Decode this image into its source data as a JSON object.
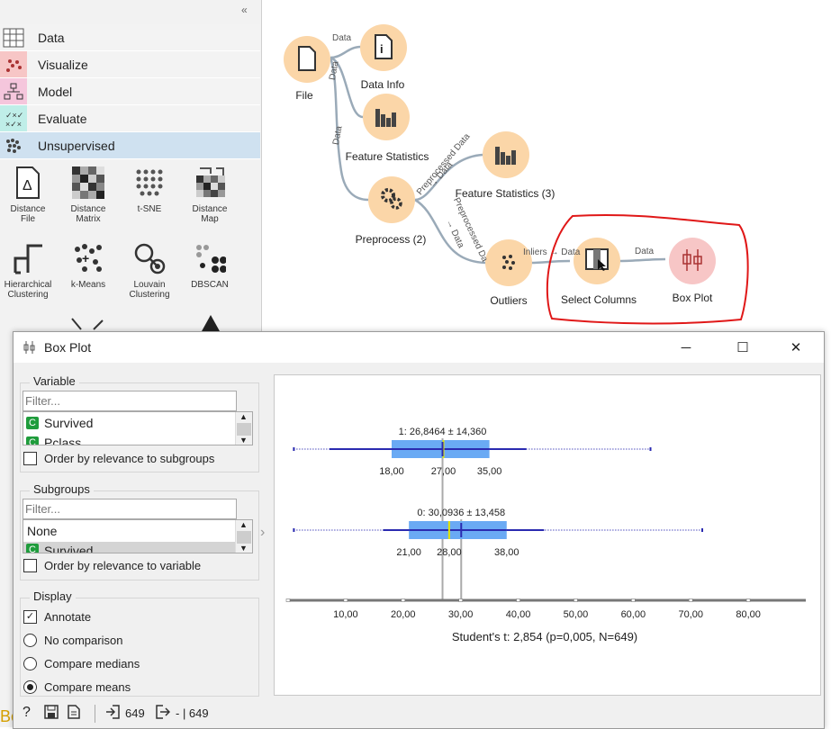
{
  "toolbox": {
    "categories": [
      {
        "label": "Data",
        "color": "#f3f3f3"
      },
      {
        "label": "Visualize",
        "color": "#f3f3f3"
      },
      {
        "label": "Model",
        "color": "#f3f3f3"
      },
      {
        "label": "Evaluate",
        "color": "#f3f3f3"
      },
      {
        "label": "Unsupervised",
        "color": "#cfe1f0"
      }
    ],
    "widgets": [
      {
        "label1": "Distance",
        "label2": "File",
        "icon": "distance-file-icon"
      },
      {
        "label1": "Distance",
        "label2": "Matrix",
        "icon": "distance-matrix-icon"
      },
      {
        "label1": "t-SNE",
        "label2": "",
        "icon": "tsne-icon"
      },
      {
        "label1": "Distance",
        "label2": "Map",
        "icon": "distance-map-icon"
      },
      {
        "label1": "Hierarchical",
        "label2": "Clustering",
        "icon": "hierarchical-clustering-icon"
      },
      {
        "label1": "k-Means",
        "label2": "",
        "icon": "kmeans-icon"
      },
      {
        "label1": "Louvain",
        "label2": "Clustering",
        "icon": "louvain-icon"
      },
      {
        "label1": "DBSCAN",
        "label2": "",
        "icon": "dbscan-icon"
      }
    ],
    "partial_label": "Box Plot"
  },
  "canvas": {
    "nodes": {
      "file": "File",
      "data_info": "Data Info",
      "feature_statistics": "Feature Statistics",
      "feature_statistics_3": "Feature Statistics (3)",
      "preprocess_2": "Preprocess (2)",
      "outliers": "Outliers",
      "select_columns": "Select Columns",
      "box_plot": "Box Plot"
    },
    "edges": {
      "file_datainfo": "Data",
      "file_featstats": "Data",
      "file_preprocess": "Data",
      "pre_fs3_a": "Preprocessed Data",
      "pre_fs3_b": "→ Data",
      "pre_out_a": "Preprocessed Da",
      "pre_out_b": "→ Data",
      "out_sel": "Inliers → Data",
      "sel_box": "Data"
    }
  },
  "window": {
    "title": "Box Plot",
    "minimize": "─",
    "maximize": "☐",
    "close": "✕",
    "variable": {
      "title": "Variable",
      "filter_placeholder": "Filter...",
      "items": [
        {
          "badge": "C",
          "label": "Survived"
        },
        {
          "badge": "C",
          "label": "Pclass"
        }
      ],
      "order_label": "Order by relevance to subgroups"
    },
    "subgroups": {
      "title": "Subgroups",
      "filter_placeholder": "Filter...",
      "items": [
        {
          "label": "None"
        },
        {
          "badge": "C",
          "label": "Survived"
        }
      ],
      "order_label": "Order by relevance to variable"
    },
    "display": {
      "title": "Display",
      "annotate": "Annotate",
      "options": [
        "No comparison",
        "Compare medians",
        "Compare means"
      ],
      "selected": 2
    },
    "status": {
      "in_count": "649",
      "out_text": "- | 649"
    }
  },
  "chart_data": {
    "type": "box",
    "groups": [
      {
        "label": "1: 26,8464 ± 14,360",
        "mean": 26.8464,
        "sd": 14.36,
        "q1": 18,
        "median": 27,
        "q3": 35,
        "q1_label": "18,00",
        "median_label": "27,00",
        "q3_label": "35,00",
        "whisker_low": 7.2,
        "whisker_high": 41.4,
        "min": 1,
        "max": 63
      },
      {
        "label": "0: 30,0936 ± 13,458",
        "mean": 30.0936,
        "sd": 13.458,
        "q1": 21,
        "median": 28,
        "q3": 38,
        "q1_label": "21,00",
        "median_label": "28,00",
        "q3_label": "38,00",
        "whisker_low": 16.5,
        "whisker_high": 44.5,
        "min": 1,
        "max": 72
      }
    ],
    "ticks": [
      10,
      20,
      30,
      40,
      50,
      60,
      70,
      80
    ],
    "tick_labels": [
      "10,00",
      "20,00",
      "30,00",
      "40,00",
      "50,00",
      "60,00",
      "70,00",
      "80,00"
    ],
    "xlim": [
      0,
      90
    ],
    "footer": "Student's t: 2,854 (p=0,005, N=649)",
    "colors": {
      "box": "#6aaaf4",
      "whisker": "#2a2ab0",
      "mean_line": "#cc2222",
      "median": "#e4e400"
    }
  }
}
